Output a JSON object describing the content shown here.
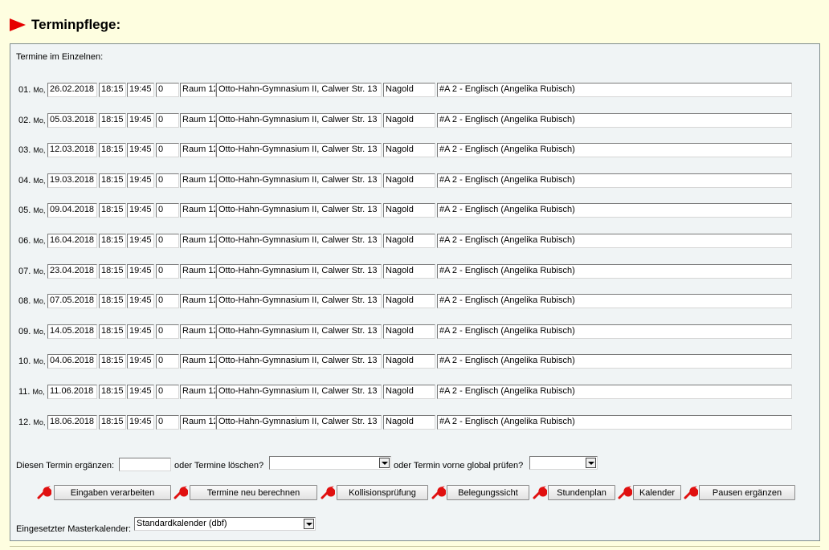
{
  "page": {
    "title": "Terminpflege:",
    "subtitle": "Termine im Einzelnen:",
    "accent_color": "#e60000"
  },
  "rows": [
    {
      "index": "01.",
      "weekday": "Mo,",
      "date": "26.02.2018",
      "from": "18:15",
      "to": "19:45",
      "z": "0",
      "room": "Raum 12",
      "location": "Otto-Hahn-Gymnasium II, Calwer Str. 13",
      "city": "Nagold",
      "course": "#A 2 - Englisch (Angelika Rubisch)"
    },
    {
      "index": "02.",
      "weekday": "Mo,",
      "date": "05.03.2018",
      "from": "18:15",
      "to": "19:45",
      "z": "0",
      "room": "Raum 12",
      "location": "Otto-Hahn-Gymnasium II, Calwer Str. 13",
      "city": "Nagold",
      "course": "#A 2 - Englisch (Angelika Rubisch)"
    },
    {
      "index": "03.",
      "weekday": "Mo,",
      "date": "12.03.2018",
      "from": "18:15",
      "to": "19:45",
      "z": "0",
      "room": "Raum 12",
      "location": "Otto-Hahn-Gymnasium II, Calwer Str. 13",
      "city": "Nagold",
      "course": "#A 2 - Englisch (Angelika Rubisch)"
    },
    {
      "index": "04.",
      "weekday": "Mo,",
      "date": "19.03.2018",
      "from": "18:15",
      "to": "19:45",
      "z": "0",
      "room": "Raum 12",
      "location": "Otto-Hahn-Gymnasium II, Calwer Str. 13",
      "city": "Nagold",
      "course": "#A 2 - Englisch (Angelika Rubisch)"
    },
    {
      "index": "05.",
      "weekday": "Mo,",
      "date": "09.04.2018",
      "from": "18:15",
      "to": "19:45",
      "z": "0",
      "room": "Raum 12",
      "location": "Otto-Hahn-Gymnasium II, Calwer Str. 13",
      "city": "Nagold",
      "course": "#A 2 - Englisch (Angelika Rubisch)"
    },
    {
      "index": "06.",
      "weekday": "Mo,",
      "date": "16.04.2018",
      "from": "18:15",
      "to": "19:45",
      "z": "0",
      "room": "Raum 12",
      "location": "Otto-Hahn-Gymnasium II, Calwer Str. 13",
      "city": "Nagold",
      "course": "#A 2 - Englisch (Angelika Rubisch)"
    },
    {
      "index": "07.",
      "weekday": "Mo,",
      "date": "23.04.2018",
      "from": "18:15",
      "to": "19:45",
      "z": "0",
      "room": "Raum 12",
      "location": "Otto-Hahn-Gymnasium II, Calwer Str. 13",
      "city": "Nagold",
      "course": "#A 2 - Englisch (Angelika Rubisch)"
    },
    {
      "index": "08.",
      "weekday": "Mo,",
      "date": "07.05.2018",
      "from": "18:15",
      "to": "19:45",
      "z": "0",
      "room": "Raum 12",
      "location": "Otto-Hahn-Gymnasium II, Calwer Str. 13",
      "city": "Nagold",
      "course": "#A 2 - Englisch (Angelika Rubisch)"
    },
    {
      "index": "09.",
      "weekday": "Mo,",
      "date": "14.05.2018",
      "from": "18:15",
      "to": "19:45",
      "z": "0",
      "room": "Raum 12",
      "location": "Otto-Hahn-Gymnasium II, Calwer Str. 13",
      "city": "Nagold",
      "course": "#A 2 - Englisch (Angelika Rubisch)"
    },
    {
      "index": "10.",
      "weekday": "Mo,",
      "date": "04.06.2018",
      "from": "18:15",
      "to": "19:45",
      "z": "0",
      "room": "Raum 12",
      "location": "Otto-Hahn-Gymnasium II, Calwer Str. 13",
      "city": "Nagold",
      "course": "#A 2 - Englisch (Angelika Rubisch)"
    },
    {
      "index": "11.",
      "weekday": "Mo,",
      "date": "11.06.2018",
      "from": "18:15",
      "to": "19:45",
      "z": "0",
      "room": "Raum 12",
      "location": "Otto-Hahn-Gymnasium II, Calwer Str. 13",
      "city": "Nagold",
      "course": "#A 2 - Englisch (Angelika Rubisch)"
    },
    {
      "index": "12.",
      "weekday": "Mo,",
      "date": "18.06.2018",
      "from": "18:15",
      "to": "19:45",
      "z": "0",
      "room": "Raum 12",
      "location": "Otto-Hahn-Gymnasium II, Calwer Str. 13",
      "city": "Nagold",
      "course": "#A 2 - Englisch (Angelika Rubisch)"
    }
  ],
  "actions": {
    "add_label": "Diesen Termin ergänzen:",
    "add_value": "",
    "delete_label": "oder Termine löschen?",
    "delete_selected": "",
    "check_label": "oder Termin vorne global prüfen?",
    "check_selected": ""
  },
  "buttons": {
    "process": "Eingaben verarbeiten",
    "recalc": "Termine neu berechnen",
    "collision": "Kollisionsprüfung",
    "occupancy": "Belegungssicht",
    "schedule": "Stundenplan",
    "calendar": "Kalender",
    "breaks": "Pausen ergänzen"
  },
  "master": {
    "label": "Eingesetzter Masterkalender:",
    "selected": "Standardkalender (dbf)"
  },
  "icons": {
    "button_icon": "wrench-icon",
    "title_icon": "triangle-arrow-icon",
    "wrench_color": "#e01010"
  }
}
